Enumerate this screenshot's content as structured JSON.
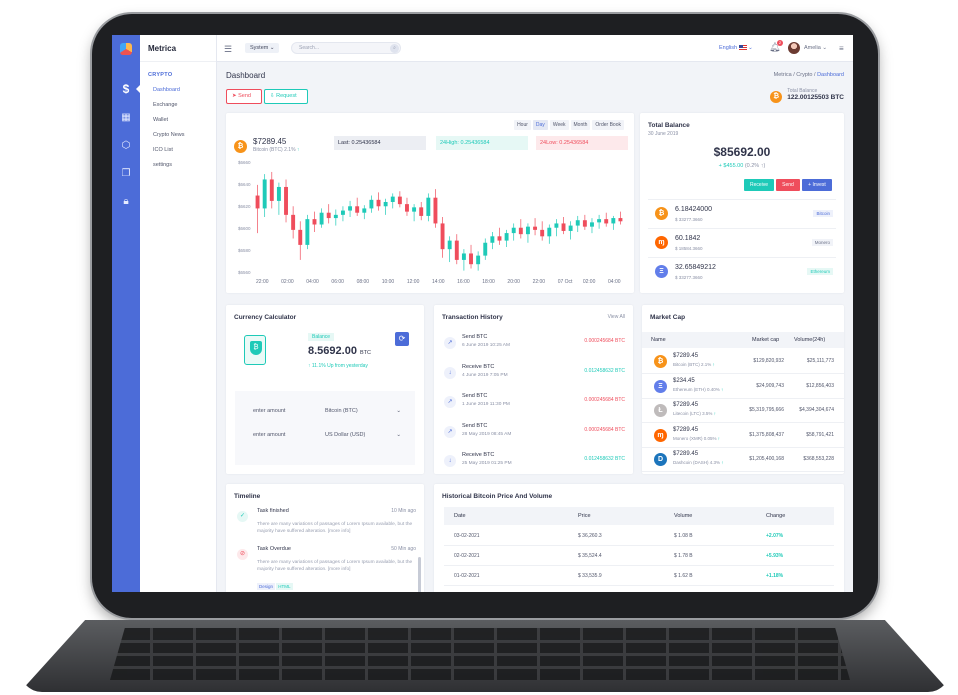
{
  "app": {
    "brand": "Metrica"
  },
  "rail": {
    "icons": [
      "dollar-icon",
      "grid-icon",
      "cube-icon",
      "copy-icon",
      "lock-icon"
    ]
  },
  "menu": {
    "section": "CRYPTO",
    "items": [
      {
        "label": "Dashboard",
        "active": true
      },
      {
        "label": "Exchange"
      },
      {
        "label": "Wallet"
      },
      {
        "label": "Crypto News"
      },
      {
        "label": "ICO List"
      },
      {
        "label": "settings"
      }
    ]
  },
  "topbar": {
    "system": "System ⌄",
    "search_placeholder": "Search...",
    "language": "English",
    "notification_count": "2",
    "user": "Amelia ⌄"
  },
  "page": {
    "title": "Dashboard",
    "breadcrumb": [
      "Metrica",
      "Crypto",
      "Dashboard"
    ],
    "send_label": "Send",
    "request_label": "Request",
    "total_balance_label": "Total Balance",
    "total_balance_value": "122.00125503 BTC"
  },
  "price_card": {
    "price": "$7289.45",
    "sub": "Bitcoin (BTC) 2.1%",
    "last": "Last: 0.25436584",
    "high": "24High: 0.25436584",
    "low": "24Low: 0.25436584",
    "tabs": [
      "Hour",
      "Day",
      "Week",
      "Month",
      "Order Book"
    ],
    "active_tab": "Day"
  },
  "chart_data": {
    "type": "candlestick",
    "y_ticks": [
      "$6660",
      "$6640",
      "$6620",
      "$6600",
      "$6580",
      "$6560"
    ],
    "x_ticks": [
      "22:00",
      "02:00",
      "04:00",
      "06:00",
      "08:00",
      "10:00",
      "12:00",
      "14:00",
      "16:00",
      "18:00",
      "20:00",
      "22:00",
      "07 Oct",
      "02:00",
      "04:00"
    ],
    "ylim": [
      6555,
      6665
    ],
    "candles": [
      [
        6630,
        6640,
        6595,
        6618
      ],
      [
        6618,
        6650,
        6610,
        6645
      ],
      [
        6645,
        6652,
        6618,
        6625
      ],
      [
        6625,
        6642,
        6612,
        6638
      ],
      [
        6638,
        6645,
        6605,
        6612
      ],
      [
        6612,
        6620,
        6590,
        6598
      ],
      [
        6598,
        6606,
        6570,
        6584
      ],
      [
        6584,
        6612,
        6580,
        6608
      ],
      [
        6608,
        6615,
        6596,
        6603
      ],
      [
        6603,
        6618,
        6600,
        6614
      ],
      [
        6614,
        6622,
        6604,
        6609
      ],
      [
        6609,
        6617,
        6602,
        6612
      ],
      [
        6612,
        6620,
        6606,
        6616
      ],
      [
        6616,
        6625,
        6610,
        6620
      ],
      [
        6620,
        6628,
        6611,
        6614
      ],
      [
        6614,
        6621,
        6608,
        6618
      ],
      [
        6618,
        6630,
        6614,
        6626
      ],
      [
        6626,
        6633,
        6616,
        6620
      ],
      [
        6620,
        6627,
        6612,
        6624
      ],
      [
        6624,
        6632,
        6618,
        6629
      ],
      [
        6629,
        6634,
        6619,
        6622
      ],
      [
        6622,
        6628,
        6611,
        6615
      ],
      [
        6615,
        6622,
        6606,
        6619
      ],
      [
        6619,
        6624,
        6607,
        6611
      ],
      [
        6611,
        6632,
        6606,
        6628
      ],
      [
        6628,
        6636,
        6600,
        6604
      ],
      [
        6604,
        6610,
        6572,
        6580
      ],
      [
        6580,
        6592,
        6568,
        6588
      ],
      [
        6588,
        6594,
        6566,
        6570
      ],
      [
        6570,
        6580,
        6560,
        6576
      ],
      [
        6576,
        6584,
        6562,
        6566
      ],
      [
        6566,
        6578,
        6560,
        6574
      ],
      [
        6574,
        6590,
        6570,
        6586
      ],
      [
        6586,
        6596,
        6580,
        6592
      ],
      [
        6592,
        6600,
        6584,
        6588
      ],
      [
        6588,
        6598,
        6582,
        6595
      ],
      [
        6595,
        6604,
        6588,
        6600
      ],
      [
        6600,
        6608,
        6590,
        6594
      ],
      [
        6594,
        6604,
        6586,
        6601
      ],
      [
        6601,
        6609,
        6593,
        6598
      ],
      [
        6598,
        6606,
        6588,
        6592
      ],
      [
        6592,
        6603,
        6585,
        6600
      ],
      [
        6600,
        6608,
        6592,
        6604
      ],
      [
        6604,
        6610,
        6594,
        6597
      ],
      [
        6597,
        6606,
        6589,
        6602
      ],
      [
        6602,
        6611,
        6596,
        6607
      ],
      [
        6607,
        6612,
        6598,
        6601
      ],
      [
        6601,
        6609,
        6595,
        6605
      ],
      [
        6605,
        6612,
        6599,
        6608
      ],
      [
        6608,
        6614,
        6601,
        6604
      ],
      [
        6604,
        6611,
        6598,
        6609
      ],
      [
        6609,
        6615,
        6603,
        6606
      ]
    ],
    "colors": {
      "up": "#1ecab8",
      "down": "#ef4d5c"
    }
  },
  "total_balance": {
    "title": "Total Balance",
    "date": "30 June 2019",
    "amount": "$85692.00",
    "change": "+ $455.00",
    "change_pct": "(0.2% ↑)",
    "actions": [
      "Receive",
      "Send",
      "+ Invest"
    ],
    "coins": [
      {
        "symbol": "₿",
        "amount": "6.18424000",
        "usd": "$ 33277.3660",
        "tag": "Bitcoin",
        "color": "btc"
      },
      {
        "symbol": "ɱ",
        "amount": "60.1842",
        "usd": "$ 18584.3660",
        "tag": "Monero",
        "color": "xmr"
      },
      {
        "symbol": "Ξ",
        "amount": "32.65849212",
        "usd": "$ 33277.3660",
        "tag": "Ethereum",
        "color": "eth"
      }
    ]
  },
  "calculator": {
    "title": "Currency Calculator",
    "balance_label": "Balance",
    "value": "8.5692.00",
    "unit": "BTC",
    "change": "↑ 11.1% Up from yesterday",
    "rows": [
      {
        "label": "enter amount",
        "currency": "Bitcoin (BTC)"
      },
      {
        "label": "enter amount",
        "currency": "US Dollar (USD)"
      }
    ]
  },
  "transactions": {
    "title": "Transaction History",
    "view_all": "View All",
    "items": [
      {
        "type": "Send BTC",
        "date": "6 June 2019 10:25 AM",
        "amount": "0.000245684 BTC",
        "dir": "out"
      },
      {
        "type": "Receive BTC",
        "date": "4 June 2019 7:05 PM",
        "amount": "0.012458632 BTC",
        "dir": "in"
      },
      {
        "type": "Send BTC",
        "date": "1 June 2019 11:30 PM",
        "amount": "0.000245684 BTC",
        "dir": "out"
      },
      {
        "type": "Send BTC",
        "date": "28 May 2019 08:45 AM",
        "amount": "0.000245684 BTC",
        "dir": "out"
      },
      {
        "type": "Receive BTC",
        "date": "25 May 2019 01:25 PM",
        "amount": "0.012458632 BTC",
        "dir": "in"
      }
    ]
  },
  "market": {
    "title": "Market Cap",
    "headers": [
      "Name",
      "Market cap",
      "Volume(24h)"
    ],
    "rows": [
      {
        "price": "$7289.45",
        "name": "Bitcoin (BTC) 2.1%",
        "cap": "$129,820,932",
        "vol": "$25,111,773",
        "color": "btc",
        "sym": "₿"
      },
      {
        "price": "$234.45",
        "name": "Ethereum (ETH) 0.40%",
        "cap": "$24,909,743",
        "vol": "$12,856,403",
        "color": "eth",
        "sym": "Ξ"
      },
      {
        "price": "$7289.45",
        "name": "Litecoin (LTC) 3.5%",
        "cap": "$5,319,795,666",
        "vol": "$4,394,304,674",
        "color": "ltc",
        "sym": "Ł"
      },
      {
        "price": "$7289.45",
        "name": "Monero (XMR) 0.05%",
        "cap": "$1,375,808,437",
        "vol": "$58,791,421",
        "color": "xmr",
        "sym": "ɱ"
      },
      {
        "price": "$7289.45",
        "name": "Dashcoin (DASH) 4.3%",
        "cap": "$1,205,400,168",
        "vol": "$368,553,228",
        "color": "dash",
        "sym": "D"
      }
    ]
  },
  "timeline": {
    "title": "Timeline",
    "items": [
      {
        "title": "Task finished",
        "time": "10 Min ago",
        "text": "There are many variations of passages of Lorem Ipsum available, but the majority have suffered alteration. [more info]",
        "kind": "ok"
      },
      {
        "title": "Task Overdue",
        "time": "50 Min ago",
        "text": "There are many variations of passages of Lorem Ipsum available, but the majority have suffered alteration. [more info]",
        "kind": "late"
      }
    ],
    "tags": [
      "Design",
      "HTML"
    ]
  },
  "history": {
    "title": "Historical Bitcoin Price And Volume",
    "headers": [
      "Date",
      "Price",
      "Volume",
      "Change"
    ],
    "rows": [
      {
        "date": "03-02-2021",
        "price": "$ 36,260.3",
        "volume": "$ 1.08 B",
        "change": "+2.07%"
      },
      {
        "date": "02-02-2021",
        "price": "$ 35,524.4",
        "volume": "$ 1.78 B",
        "change": "+5.93%"
      },
      {
        "date": "01-02-2021",
        "price": "$ 33,535.9",
        "volume": "$ 1.62 B",
        "change": "+1.18%"
      }
    ]
  }
}
